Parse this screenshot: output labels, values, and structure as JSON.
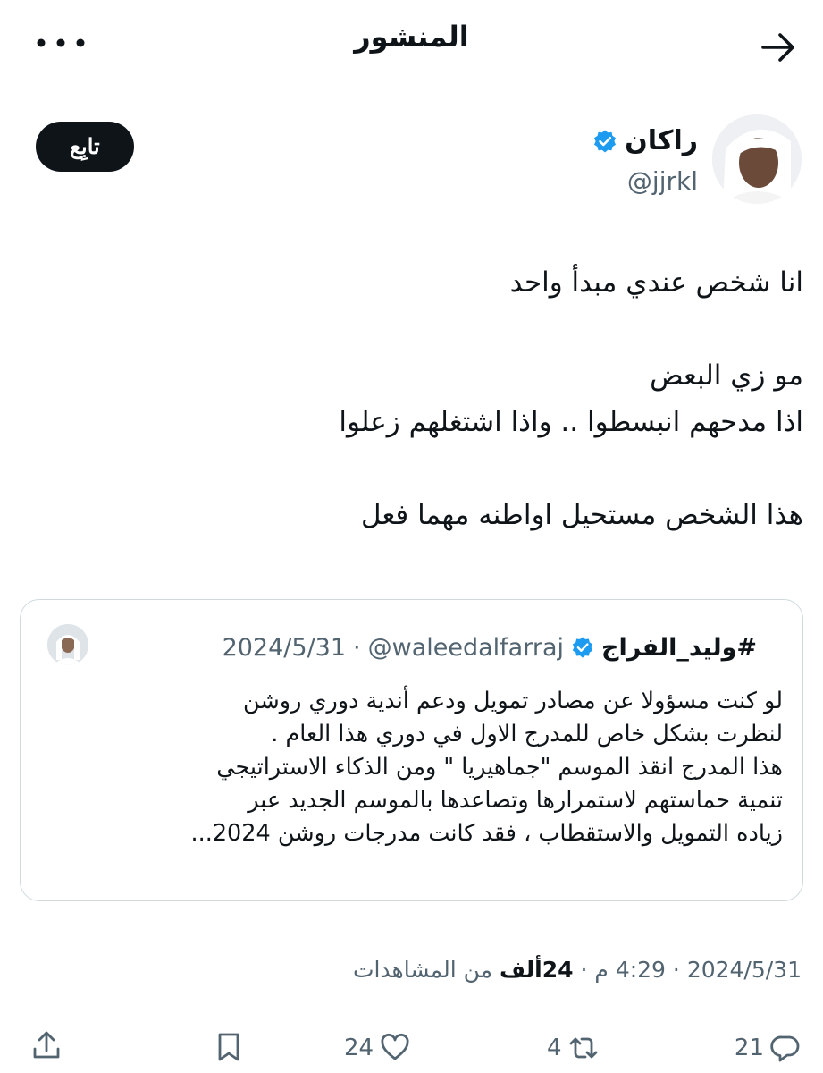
{
  "header": {
    "title": "المنشور",
    "back_icon": "arrow-right-icon",
    "more_icon": "more-dots-icon"
  },
  "author": {
    "name": "راكان",
    "handle": "@jjrkl",
    "verified": true,
    "follow_label": "تابِع"
  },
  "post": {
    "text": "انا شخص عندي مبدأ واحد\n\nمو زي البعض\nاذا مدحهم انبسطوا .. واذا اشتغلهم زعلوا\n\nهذا الشخص مستحيل اواطنه مهما فعل"
  },
  "quote": {
    "name": "#وليد_الفراج",
    "handle": "@waleedalfarraj",
    "separator": "·",
    "date": "2024/5/31",
    "text": "لو كنت مسؤولا عن مصادر تمويل ودعم أندية دوري روشن\nلنظرت بشكل خاص للمدرج الاول في دوري هذا العام .\nهذا المدرج انقذ الموسم \"جماهيريا \" ومن الذكاء الاستراتيجي\nتنمية حماستهم لاستمرارها وتصاعدها بالموسم الجديد عبر\nزياده التمويل والاستقطاب ، فقد كانت مدرجات روشن 2024..."
  },
  "meta": {
    "date": "2024/5/31",
    "time": "4:29 م",
    "views_count": "24ألف",
    "views_label": "من المشاهدات",
    "separator": "·"
  },
  "actions": {
    "replies": "21",
    "reposts": "4",
    "likes": "24"
  },
  "colors": {
    "text": "#0f1419",
    "secondary": "#536471",
    "verified": "#1d9bf0",
    "border": "#cfd9de"
  }
}
